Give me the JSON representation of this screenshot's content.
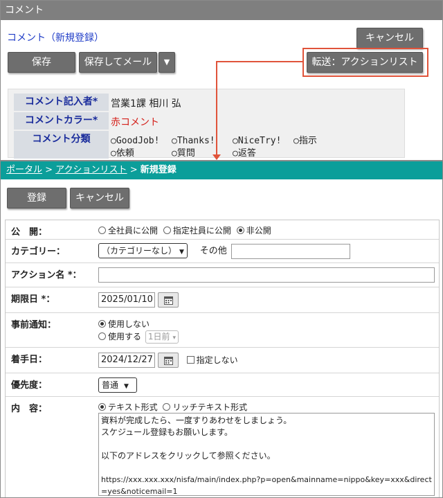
{
  "top_panel": {
    "header": "コメント",
    "title": "コメント（新規登録）",
    "cancel_label": "キャンセル",
    "save_label": "保存",
    "save_mail_label": "保存してメール",
    "dropdown_caret": "▼",
    "forward_label": "転送：アクションリスト",
    "highlight_color": "#e0533a",
    "fields": {
      "author_label": "コメント記入者*",
      "author_value": "営業1課 相川 弘",
      "color_label": "コメントカラー*",
      "color_value": "赤コメント",
      "color_value_color": "#d4201a",
      "category_label": "コメント分類",
      "category_options_row1": [
        "GoodJob!",
        "Thanks!",
        "NiceTry!",
        "指示"
      ],
      "category_options_row2": [
        "依頼",
        "質問",
        "返答"
      ]
    }
  },
  "bottom_panel": {
    "breadcrumb": {
      "portal": "ポータル",
      "sep": ">",
      "action_list": "アクションリスト",
      "current": "新規登録"
    },
    "header_color": "#0b9e9a",
    "register_label": "登録",
    "cancel_label": "キャンセル",
    "form": {
      "visibility": {
        "label": "公　開：",
        "options": [
          "全社員に公開",
          "指定社員に公開",
          "非公開"
        ],
        "selected": "非公開"
      },
      "category": {
        "label": "カテゴリー：",
        "value": "（カテゴリーなし）",
        "other_label": "その他",
        "other_value": ""
      },
      "action_name": {
        "label": "アクション名 *：",
        "value": ""
      },
      "deadline": {
        "label": "期限日 *：",
        "value": "2025/01/10"
      },
      "advance_notice": {
        "label": "事前通知：",
        "option_off": "使用しない",
        "option_on": "使用する",
        "selected": "使用しない",
        "timing_value": "1日前"
      },
      "start_date": {
        "label": "着手日：",
        "value": "2024/12/27",
        "no_specify_label": "指定しない"
      },
      "priority": {
        "label": "優先度：",
        "value": "普通"
      },
      "content": {
        "label": "内　容：",
        "format_text": "テキスト形式",
        "format_rich": "リッチテキスト形式",
        "selected": "テキスト形式",
        "lines": [
          "資料が完成したら、一度すりあわせをしましょう。",
          "スケジュール登録もお願いします。",
          "",
          "以下のアドレスをクリックして参照ください。",
          "",
          "https://xxx.xxx.xxx/nisfa/main/index.php?p=open&mainname=nippo&key=xxx&direct",
          "=yes&noticemail=1"
        ]
      }
    }
  }
}
